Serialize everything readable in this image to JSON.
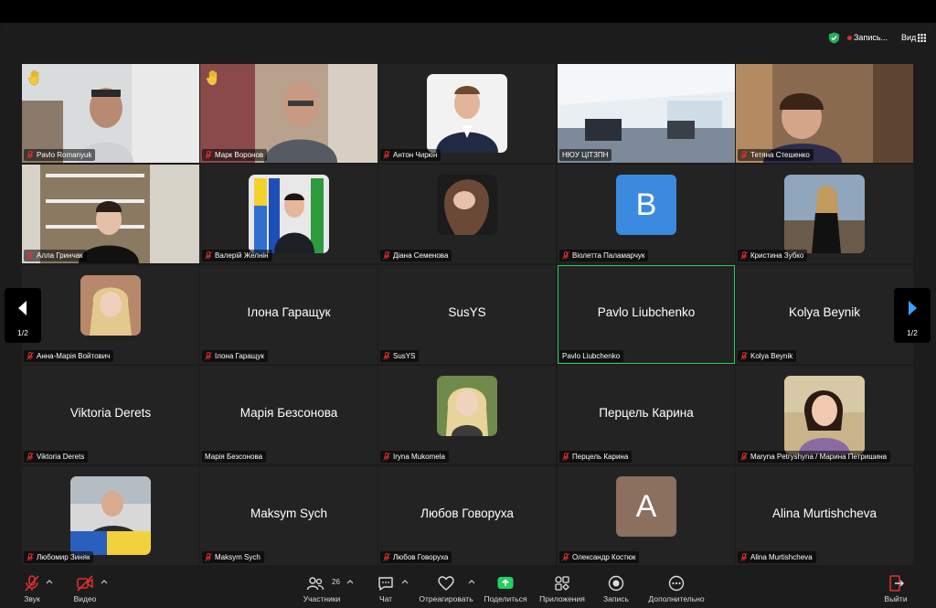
{
  "header": {
    "record_label": "Запись...",
    "view_label": "Вид"
  },
  "pager": {
    "left_page": "1/2",
    "right_page": "1/2"
  },
  "tiles": [
    {
      "name": "Pavlo Romanyuk",
      "hand": true
    },
    {
      "name": "Марк Воронов",
      "hand": true
    },
    {
      "name": "Антон Чиркін"
    },
    {
      "name": "НЮУ ЦІТЗПН"
    },
    {
      "name": "Тетяна Стешенко"
    },
    {
      "name": "Алла Гринчак"
    },
    {
      "name": "Валерій Желнін"
    },
    {
      "name": "Діана Семенова"
    },
    {
      "name": "Віолетта Паламарчук",
      "avatar_letter": "В",
      "avatar_color": "#3a8be0"
    },
    {
      "name": "Кристина Зубко"
    },
    {
      "name": "Анна-Марія Войтович"
    },
    {
      "name": "Ілона Гаращук",
      "display": "Ілона Гаращук"
    },
    {
      "name": "SusYS",
      "display": "SusYS"
    },
    {
      "name": "Pavlo Liubchenko",
      "display": "Pavlo Liubchenko",
      "active": true
    },
    {
      "name": "Kolya Beynik",
      "display": "Kolya Beynik"
    },
    {
      "name": "Viktoria Derets",
      "display": "Viktoria Derets"
    },
    {
      "name": "Марія Безсонова",
      "display": "Марія Безсонова"
    },
    {
      "name": "Iryna Mukomela"
    },
    {
      "name": "Перцель Карина",
      "display": "Перцель Карина"
    },
    {
      "name": "Maryna Petryshyna / Марина Петришина"
    },
    {
      "name": "Любомир Зиняк"
    },
    {
      "name": "Maksym Sych",
      "display": "Maksym Sych"
    },
    {
      "name": "Любов Говоруха",
      "display": "Любов Говоруха"
    },
    {
      "name": "Олександр Костюк",
      "avatar_letter": "A",
      "avatar_color": "#8b6f5f"
    },
    {
      "name": "Alina Murtishcheva",
      "display": "Alina Murtishcheva"
    }
  ],
  "toolbar": {
    "audio": "Звук",
    "video": "Видео",
    "participants": "Участники",
    "participants_count": "26",
    "chat": "Чат",
    "react": "Отреагировать",
    "share": "Поделиться",
    "apps": "Приложения",
    "record": "Запись",
    "more": "Дополнительно",
    "leave": "Выйти"
  },
  "colors": {
    "active_border": "#23d160",
    "share_green": "#23d160",
    "leave_red": "#e0312e",
    "muted_red": "#e0312e"
  }
}
